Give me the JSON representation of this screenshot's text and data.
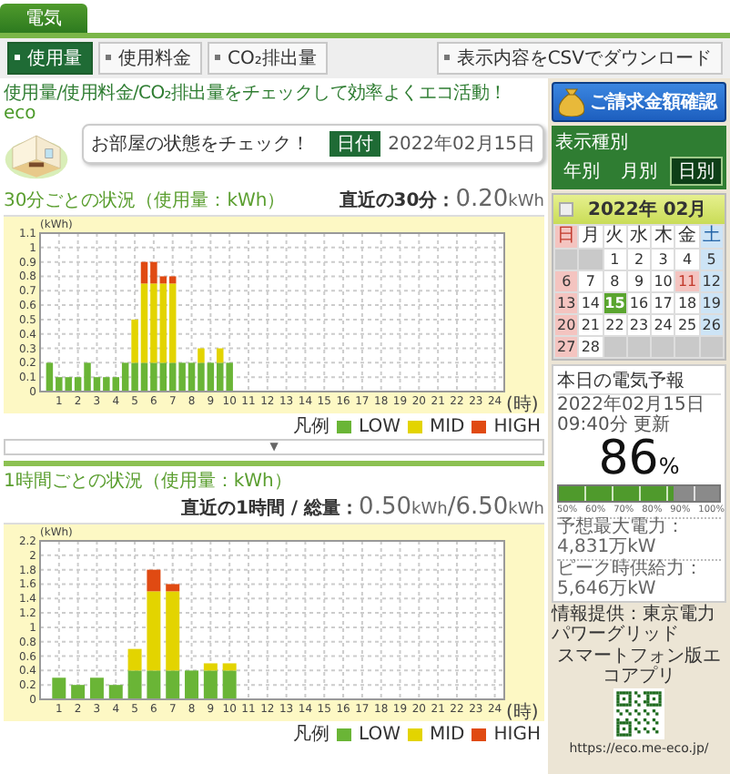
{
  "top_tabs": [
    {
      "label": "電気",
      "selected": true
    }
  ],
  "sub_tabs": [
    {
      "label": "使用量",
      "selected": true
    },
    {
      "label": "使用料金",
      "selected": false
    },
    {
      "label": "CO₂排出量",
      "selected": false
    }
  ],
  "csv_button": "表示内容をCSVでダウンロード",
  "banner": {
    "logo": "eco",
    "headline": "使用量/使用料金/CO₂排出量をチェックして効率よくエコ活動！",
    "title": "お部屋の状態をチェック！",
    "date_badge": "日付",
    "date": "2022年02月15日"
  },
  "charts": [
    {
      "title": "30分ごとの状況（使用量：kWh）",
      "reading_label": "直近の30分：",
      "readings": [
        {
          "value": "0.20",
          "unit": "kWh"
        }
      ],
      "legend_label": "凡例",
      "chart_data": {
        "type": "bar",
        "stacked": true,
        "ylabel": "(kWh)",
        "xlabel": "(時)",
        "xlim": [
          0,
          24.5
        ],
        "ylim": [
          0,
          1.1
        ],
        "grid": true,
        "x": [
          0.5,
          1,
          1.5,
          2,
          2.5,
          3,
          3.5,
          4,
          4.5,
          5,
          5.5,
          6,
          6.5,
          7,
          7.5,
          8,
          8.5,
          9,
          9.5,
          10
        ],
        "xticks": [
          1,
          2,
          3,
          4,
          5,
          6,
          7,
          8,
          9,
          10,
          11,
          12,
          13,
          14,
          15,
          16,
          17,
          18,
          19,
          20,
          21,
          22,
          23,
          24
        ],
        "yticks": [
          0,
          0.1,
          0.2,
          0.3,
          0.4,
          0.5,
          0.6,
          0.7,
          0.8,
          0.9,
          1,
          1.1
        ],
        "series": [
          {
            "name": "LOW",
            "color": "#6ab536",
            "values": [
              0.2,
              0.1,
              0.1,
              0.1,
              0.2,
              0.1,
              0.1,
              0.1,
              0.2,
              0.2,
              0.2,
              0.2,
              0.2,
              0.2,
              0.2,
              0.2,
              0.2,
              0.2,
              0.2,
              0.2
            ]
          },
          {
            "name": "MID",
            "color": "#e3d400",
            "values": [
              0,
              0,
              0,
              0,
              0,
              0,
              0,
              0,
              0,
              0.3,
              0.55,
              0.55,
              0.55,
              0.55,
              0,
              0,
              0.1,
              0,
              0.1,
              0
            ]
          },
          {
            "name": "HIGH",
            "color": "#e04a12",
            "values": [
              0,
              0,
              0,
              0,
              0,
              0,
              0,
              0,
              0,
              0,
              0.15,
              0.15,
              0.05,
              0.05,
              0,
              0,
              0,
              0,
              0,
              0
            ]
          }
        ]
      }
    },
    {
      "title": "1時間ごとの状況（使用量：kWh）",
      "reading_label": "直近の1時間 / 総量：",
      "readings": [
        {
          "value": "0.50",
          "unit": "kWh"
        },
        {
          "value": "6.50",
          "unit": "kWh"
        }
      ],
      "separator": "/",
      "legend_label": "凡例",
      "chart_data": {
        "type": "bar",
        "stacked": true,
        "ylabel": "(kWh)",
        "xlabel": "(時)",
        "xlim": [
          0,
          24.5
        ],
        "ylim": [
          0,
          2.2
        ],
        "grid": true,
        "x": [
          1,
          2,
          3,
          4,
          5,
          6,
          7,
          8,
          9,
          10
        ],
        "xticks": [
          1,
          2,
          3,
          4,
          5,
          6,
          7,
          8,
          9,
          10,
          11,
          12,
          13,
          14,
          15,
          16,
          17,
          18,
          19,
          20,
          21,
          22,
          23,
          24
        ],
        "yticks": [
          0,
          0.2,
          0.4,
          0.6,
          0.8,
          1,
          1.2,
          1.4,
          1.6,
          1.8,
          2,
          2.2
        ],
        "series": [
          {
            "name": "LOW",
            "color": "#6ab536",
            "values": [
              0.3,
              0.2,
              0.3,
              0.2,
              0.4,
              0.4,
              0.4,
              0.4,
              0.4,
              0.4
            ]
          },
          {
            "name": "MID",
            "color": "#e3d400",
            "values": [
              0,
              0,
              0,
              0,
              0.3,
              1.1,
              1.1,
              0,
              0.1,
              0.1
            ]
          },
          {
            "name": "HIGH",
            "color": "#e04a12",
            "values": [
              0,
              0,
              0,
              0,
              0,
              0.3,
              0.1,
              0,
              0,
              0
            ]
          }
        ]
      }
    }
  ],
  "toggle": "▼",
  "billing_button": "ご請求金額確認",
  "view": {
    "label": "表示種別",
    "tabs": [
      {
        "label": "年別",
        "selected": false
      },
      {
        "label": "月別",
        "selected": false
      },
      {
        "label": "日別",
        "selected": true
      }
    ]
  },
  "calendar": {
    "title": "2022年 02月",
    "weekdays": [
      {
        "label": "日",
        "kind": "sunday"
      },
      {
        "label": "月",
        "kind": "weekday"
      },
      {
        "label": "火",
        "kind": "weekday"
      },
      {
        "label": "水",
        "kind": "weekday"
      },
      {
        "label": "木",
        "kind": "weekday"
      },
      {
        "label": "金",
        "kind": "weekday"
      },
      {
        "label": "土",
        "kind": "saturday"
      }
    ],
    "weeks": [
      [
        {
          "kind": "empty"
        },
        {
          "kind": "empty"
        },
        {
          "label": "1",
          "kind": "weekday",
          "selected": false
        },
        {
          "label": "2",
          "kind": "weekday",
          "selected": false
        },
        {
          "label": "3",
          "kind": "weekday",
          "selected": false
        },
        {
          "label": "4",
          "kind": "weekday",
          "selected": false
        },
        {
          "label": "5",
          "kind": "saturday",
          "selected": false
        }
      ],
      [
        {
          "label": "6",
          "kind": "sunday",
          "selected": false
        },
        {
          "label": "7",
          "kind": "weekday",
          "selected": false
        },
        {
          "label": "8",
          "kind": "weekday",
          "selected": false
        },
        {
          "label": "9",
          "kind": "weekday",
          "selected": false
        },
        {
          "label": "10",
          "kind": "weekday",
          "selected": false
        },
        {
          "label": "11",
          "kind": "holiday",
          "selected": false
        },
        {
          "label": "12",
          "kind": "saturday",
          "selected": false
        }
      ],
      [
        {
          "label": "13",
          "kind": "sunday",
          "selected": false
        },
        {
          "label": "14",
          "kind": "weekday",
          "selected": false
        },
        {
          "label": "15",
          "kind": "weekday",
          "selected": true
        },
        {
          "label": "16",
          "kind": "weekday",
          "selected": false
        },
        {
          "label": "17",
          "kind": "weekday",
          "selected": false
        },
        {
          "label": "18",
          "kind": "weekday",
          "selected": false
        },
        {
          "label": "19",
          "kind": "saturday",
          "selected": false
        }
      ],
      [
        {
          "label": "20",
          "kind": "sunday",
          "selected": false
        },
        {
          "label": "21",
          "kind": "weekday",
          "selected": false
        },
        {
          "label": "22",
          "kind": "weekday",
          "selected": false
        },
        {
          "label": "23",
          "kind": "weekday",
          "selected": false
        },
        {
          "label": "24",
          "kind": "weekday",
          "selected": false
        },
        {
          "label": "25",
          "kind": "weekday",
          "selected": false
        },
        {
          "label": "26",
          "kind": "saturday",
          "selected": false
        }
      ],
      [
        {
          "label": "27",
          "kind": "sunday",
          "selected": false
        },
        {
          "label": "28",
          "kind": "weekday",
          "selected": false
        },
        {
          "kind": "empty"
        },
        {
          "kind": "empty"
        },
        {
          "kind": "empty"
        },
        {
          "kind": "empty"
        },
        {
          "kind": "empty"
        }
      ]
    ]
  },
  "forecast": {
    "title": "本日の電気予報",
    "updated": "2022年02月15日 09:40分 更新",
    "value": "86",
    "unit": "%",
    "meter": {
      "level": 0.72,
      "scale": [
        "50%",
        "60%",
        "70%",
        "80%",
        "90%",
        "100%"
      ]
    },
    "lines": [
      "予想最大電力：4,831万kW",
      "ピーク時供給力：5,646万kW"
    ],
    "source": "情報提供：東京電力パワーグリッド"
  },
  "app": {
    "label": "スマートフォン版エコアプリ",
    "url": "https://eco.me-eco.jp/"
  }
}
